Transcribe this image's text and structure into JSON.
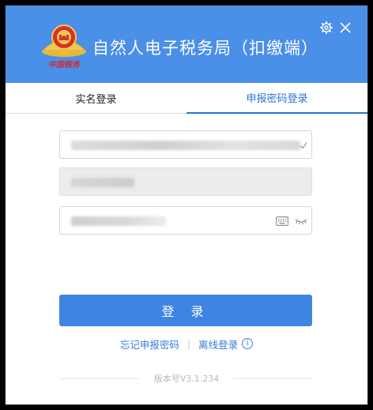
{
  "header": {
    "title": "自然人电子税务局（扣缴端）",
    "emblem_text": "中国税务",
    "settings_icon": "gear-icon",
    "close_icon": "close-icon",
    "bg_color": "#4a8fe8"
  },
  "tabs": [
    {
      "label": "实名登录",
      "active": false
    },
    {
      "label": "申报密码登录",
      "active": true
    }
  ],
  "form": {
    "account_value": "",
    "account_icon": "check-icon",
    "name_value": "",
    "password_value": "",
    "keyboard_icon": "keyboard-icon",
    "eye_icon": "eye-closed-icon",
    "login_label": "登 录"
  },
  "links": {
    "forgot": "忘记申报密码",
    "separator": "|",
    "offline": "离线登录",
    "info_icon": "info-icon"
  },
  "footer": {
    "version": "版本号V3.1.234"
  }
}
